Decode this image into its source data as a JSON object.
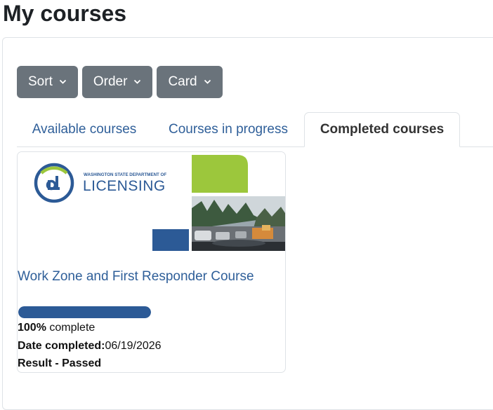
{
  "page": {
    "title": "My courses"
  },
  "toolbar": {
    "sort_label": "Sort",
    "order_label": "Order",
    "view_label": "Card",
    "button_color": "#6a737b"
  },
  "tabs": [
    {
      "label": "Available courses",
      "active": false
    },
    {
      "label": "Courses in progress",
      "active": false
    },
    {
      "label": "Completed courses",
      "active": true
    }
  ],
  "course": {
    "logo_small_text": "WASHINGTON STATE DEPARTMENT OF",
    "logo_big_text": "LICENSING",
    "logo_mark": "dL",
    "name": "Work Zone and First Responder Course",
    "progress_percent": 100,
    "progress_value": "100%",
    "progress_suffix": " complete",
    "date_label": "Date completed:",
    "date_value": "06/19/2026",
    "result": "Result - Passed",
    "progress_color": "#2c5a96"
  }
}
